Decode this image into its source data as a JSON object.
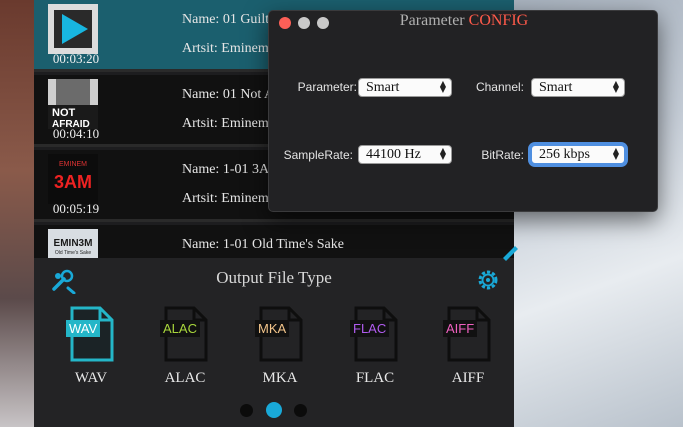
{
  "tracks": [
    {
      "name": "Name: 01 Guilt",
      "artist": "Artsit: Eminem",
      "duration": "00:03:20",
      "selected": true
    },
    {
      "name": "Name: 01 Not A",
      "artist": "Artsit: Eminem",
      "duration": "00:04:10",
      "selected": false
    },
    {
      "name": "Name: 1-01 3A",
      "artist": "Artsit: Eminem",
      "duration": "00:05:19",
      "selected": false
    },
    {
      "name": "Name: 1-01 Old Time's Sake",
      "artist": "",
      "duration": "",
      "selected": false
    }
  ],
  "album_art_text": {
    "t2_line1": "NOT",
    "t2_line2": "AFRAID",
    "t3_line1": "EMINEM",
    "t3_line2": "3AM",
    "t4_line1": "EMIN3M",
    "t4_line2": "Old Time's Sake"
  },
  "output": {
    "title": "Output File Type",
    "types": [
      {
        "badge": "WAV",
        "label": "WAV",
        "color": "#24b6c8",
        "selected": true
      },
      {
        "badge": "ALAC",
        "label": "ALAC",
        "color": "#a8d63c",
        "selected": false
      },
      {
        "badge": "MKA",
        "label": "MKA",
        "color": "#f2c48a",
        "selected": false
      },
      {
        "badge": "FLAC",
        "label": "FLAC",
        "color": "#b15cf0",
        "selected": false
      },
      {
        "badge": "AIFF",
        "label": "AIFF",
        "color": "#f060c0",
        "selected": false
      }
    ],
    "page_active": 2,
    "page_count": 3
  },
  "config": {
    "title_prefix": "Parameter",
    "title_accent": "CONFIG",
    "parameter_label": "Parameter:",
    "parameter_value": "Smart",
    "channel_label": "Channel:",
    "channel_value": "Smart",
    "samplerate_label": "SampleRate:",
    "samplerate_value": "44100 Hz",
    "bitrate_label": "BitRate:",
    "bitrate_value": "256 kbps"
  },
  "colors": {
    "accent": "#1b5f6e",
    "teal": "#19a9d8",
    "title_accent": "#ff5a4a"
  }
}
